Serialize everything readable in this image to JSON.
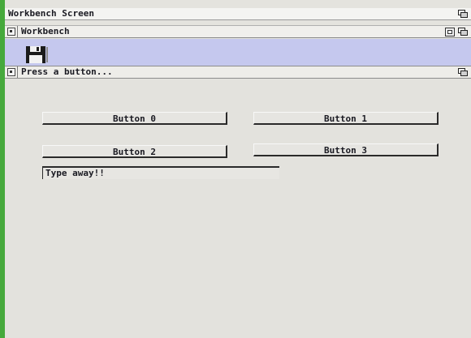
{
  "screen": {
    "title": "Workbench Screen"
  },
  "workbench_window": {
    "title": "Workbench"
  },
  "program_window": {
    "title": "Press a button..."
  },
  "buttons": [
    {
      "label": "Button 0"
    },
    {
      "label": "Button 1"
    },
    {
      "label": "Button 2"
    },
    {
      "label": "Button 3"
    }
  ],
  "text_field": {
    "value": "Type away!!"
  },
  "icons": [
    "floppy-disk-icon",
    "depth-gadget-icon",
    "zoom-gadget-icon",
    "close-gadget-icon"
  ],
  "colors": {
    "background_green": "#46a93c",
    "workbench_blue": "#c5c8ee",
    "window_gray": "#e3e2dd"
  }
}
